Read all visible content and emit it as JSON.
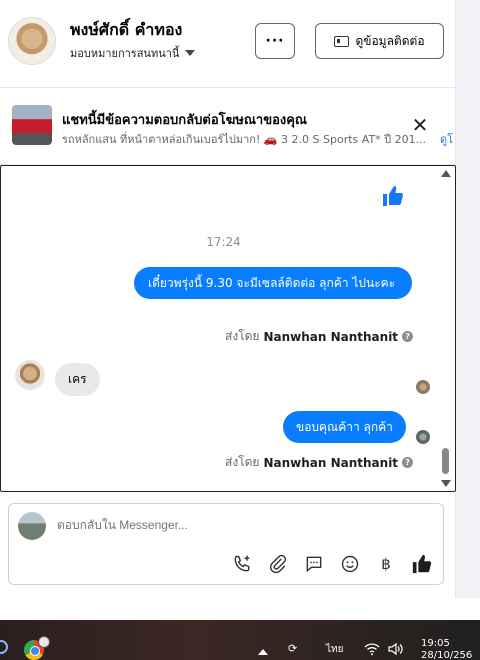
{
  "header": {
    "user_name": "พงษ์ศักดิ์ คำทอง",
    "assign_label": "มอบหมายการสนทนานี้",
    "more_label": "···",
    "contact_label": "ดูข้อมูลติดต่อ"
  },
  "ad": {
    "title": "แชทนี้มีข้อความตอบกลับต่อโฆษณาของคุณ",
    "subtitle": "รถหลักแสน ที่หน้าตาหล่อเกินเบอร์ไปมาก! 🚗 3 2.0 S Sports AT* ปี 201...",
    "more_link": "ดูโ",
    "close_label": "✕"
  },
  "conversation": {
    "timestamp": "17:24",
    "messages": [
      {
        "direction": "out",
        "text": "เดี๋ยวพรุ่งนี้ 9.30 จะมีเซลล์ติดต่อ ลุกค้า  ไปนะคะ"
      },
      {
        "direction": "in",
        "text": "เคร"
      },
      {
        "direction": "out",
        "text": "ขอบคุณค้าา ลุกค้า"
      }
    ],
    "sent_by_prefix": "ส่งโดย",
    "sent_by_name": "Nanwhan Nanthanit",
    "help_mark": "?"
  },
  "composer": {
    "placeholder": "ตอบกลับใน Messenger...",
    "tools": [
      "call-add-icon",
      "attach-icon",
      "saved-reply-icon",
      "emoji-icon",
      "baht-icon",
      "like-icon"
    ],
    "baht_symbol": "฿"
  },
  "taskbar": {
    "language": "ไทย",
    "time": "19:05",
    "date": "28/10/256"
  },
  "colors": {
    "messenger_blue": "#0a7cff",
    "incoming_bubble": "#e9e9eb",
    "like_blue": "#1877f2"
  }
}
